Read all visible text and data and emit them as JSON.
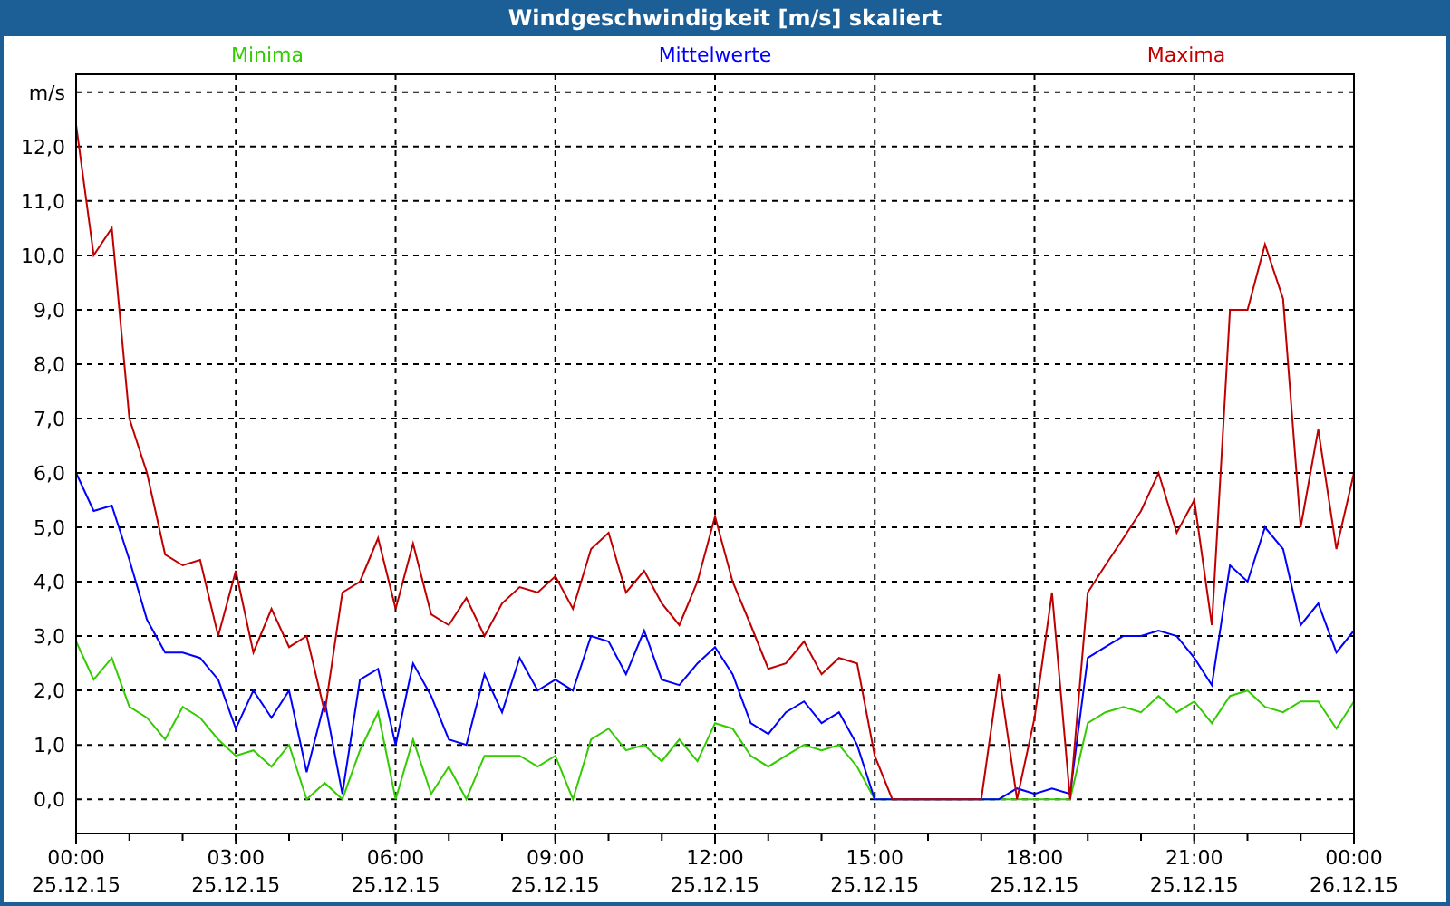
{
  "window": {
    "title": "Windgeschwindigkeit [m/s] skaliert"
  },
  "chart": {
    "chart_data": {
      "type": "line",
      "x": [
        0,
        0.33,
        0.67,
        1,
        1.33,
        1.67,
        2,
        2.33,
        2.67,
        3,
        3.33,
        3.67,
        4,
        4.33,
        4.67,
        5,
        5.33,
        5.67,
        6,
        6.33,
        6.67,
        7,
        7.33,
        7.67,
        8,
        8.33,
        8.67,
        9,
        9.33,
        9.67,
        10,
        10.33,
        10.67,
        11,
        11.33,
        11.67,
        12,
        12.33,
        12.67,
        13,
        13.33,
        13.67,
        14,
        14.33,
        14.67,
        15,
        15.33,
        15.67,
        16,
        16.33,
        16.67,
        17,
        17.33,
        17.67,
        18,
        18.33,
        18.67,
        19,
        19.33,
        19.67,
        20,
        20.33,
        20.67,
        21,
        21.33,
        21.67,
        22,
        22.33,
        22.67,
        23,
        23.33,
        23.67,
        24
      ],
      "series": [
        {
          "name": "Minima",
          "color": "#33cc00",
          "values": [
            2.9,
            2.2,
            2.6,
            1.7,
            1.5,
            1.1,
            1.7,
            1.5,
            1.1,
            0.8,
            0.9,
            0.6,
            1.0,
            0,
            0.3,
            0,
            0.9,
            1.6,
            0,
            1.1,
            0.1,
            0.6,
            0,
            0.8,
            0.8,
            0.8,
            0.6,
            0.8,
            0,
            1.1,
            1.3,
            0.9,
            1.0,
            0.7,
            1.1,
            0.7,
            1.4,
            1.3,
            0.8,
            0.6,
            0.8,
            1.0,
            0.9,
            1.0,
            0.6,
            0,
            0,
            0,
            0,
            0,
            0,
            0,
            0,
            0,
            0,
            0,
            0,
            1.4,
            1.6,
            1.7,
            1.6,
            1.9,
            1.6,
            1.8,
            1.4,
            1.9,
            2.0,
            1.7,
            1.6,
            1.8,
            1.8,
            1.3,
            1.8
          ]
        },
        {
          "name": "Mittelwerte",
          "color": "#0000ff",
          "values": [
            6.0,
            5.3,
            5.4,
            4.4,
            3.3,
            2.7,
            2.7,
            2.6,
            2.2,
            1.3,
            2.0,
            1.5,
            2.0,
            0.5,
            1.8,
            0.1,
            2.2,
            2.4,
            1.0,
            2.5,
            1.9,
            1.1,
            1.0,
            2.3,
            1.6,
            2.6,
            2.0,
            2.2,
            2.0,
            3.0,
            2.9,
            2.3,
            3.1,
            2.2,
            2.1,
            2.5,
            2.8,
            2.3,
            1.4,
            1.2,
            1.6,
            1.8,
            1.4,
            1.6,
            1.0,
            0,
            0,
            0,
            0,
            0,
            0,
            0,
            0,
            0.2,
            0.1,
            0.2,
            0.1,
            2.6,
            2.8,
            3.0,
            3.0,
            3.1,
            3.0,
            2.6,
            2.1,
            4.3,
            4.0,
            5.0,
            4.6,
            3.2,
            3.6,
            2.7,
            3.1
          ]
        },
        {
          "name": "Maxima",
          "color": "#c00000",
          "values": [
            12.4,
            10.0,
            10.5,
            7.0,
            6.0,
            4.5,
            4.3,
            4.4,
            3.0,
            4.2,
            2.7,
            3.5,
            2.8,
            3.0,
            1.6,
            3.8,
            4.0,
            4.8,
            3.5,
            4.7,
            3.4,
            3.2,
            3.7,
            3.0,
            3.6,
            3.9,
            3.8,
            4.1,
            3.5,
            4.6,
            4.9,
            3.8,
            4.2,
            3.6,
            3.2,
            4.0,
            5.2,
            4.0,
            3.2,
            2.4,
            2.5,
            2.9,
            2.3,
            2.6,
            2.5,
            0.8,
            0,
            0,
            0,
            0,
            0,
            0,
            2.3,
            0,
            1.5,
            3.8,
            0,
            3.8,
            4.3,
            4.8,
            5.3,
            6.0,
            4.9,
            5.5,
            3.2,
            9.0,
            9.0,
            10.2,
            9.2,
            5.0,
            6.8,
            4.6,
            6.0
          ]
        }
      ],
      "grid": true,
      "xlim": [
        0,
        24
      ],
      "ylim": [
        -0.63,
        13.33
      ],
      "xticks": [
        {
          "value": 0,
          "label": "00:00"
        },
        {
          "value": 3,
          "label": "03:00"
        },
        {
          "value": 6,
          "label": "06:00"
        },
        {
          "value": 9,
          "label": "09:00"
        },
        {
          "value": 12,
          "label": "12:00"
        },
        {
          "value": 15,
          "label": "15:00"
        },
        {
          "value": 18,
          "label": "18:00"
        },
        {
          "value": 21,
          "label": "21:00"
        },
        {
          "value": 24,
          "label": "00:00"
        }
      ],
      "yticks": [
        {
          "value": 0,
          "label": "0,0"
        },
        {
          "value": 1,
          "label": "1,0"
        },
        {
          "value": 2,
          "label": "2,0"
        },
        {
          "value": 3,
          "label": "3,0"
        },
        {
          "value": 4,
          "label": "4,0"
        },
        {
          "value": 5,
          "label": "5,0"
        },
        {
          "value": 6,
          "label": "6,0"
        },
        {
          "value": 7,
          "label": "7,0"
        },
        {
          "value": 8,
          "label": "8,0"
        },
        {
          "value": 9,
          "label": "9,0"
        },
        {
          "value": 10,
          "label": "10,0"
        },
        {
          "value": 11,
          "label": "11,0"
        },
        {
          "value": 12,
          "label": "12,0"
        },
        {
          "value": 13,
          "label": "m/s"
        }
      ]
    },
    "date_labels": [
      "25.12.15",
      "25.12.15",
      "25.12.15",
      "25.12.15",
      "25.12.15",
      "25.12.15",
      "25.12.15",
      "25.12.15",
      "26.12.15"
    ]
  }
}
